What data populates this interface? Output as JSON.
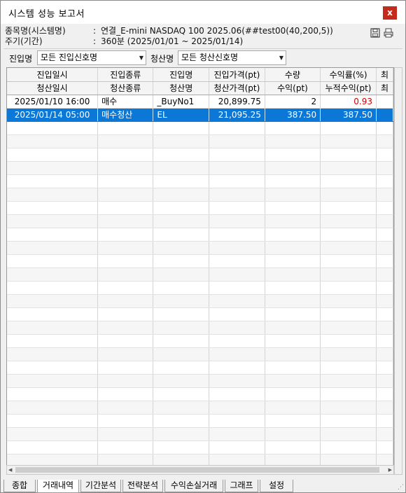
{
  "window": {
    "title": "시스템 성능 보고서",
    "close_label": "x"
  },
  "info": {
    "symbol_label": "종목명(시스템명)",
    "symbol_value": "연결_E-mini NASDAQ 100 2025.06(##test00(40,200,5))",
    "period_label": "주기(기간)",
    "period_value": "360분 (2025/01/01 ~ 2025/01/14)"
  },
  "filters": {
    "entry_label": "진입명",
    "entry_value": "모든 진입신호명",
    "exit_label": "청산명",
    "exit_value": "모든 청산신호명"
  },
  "table": {
    "header_top": [
      "진입일시",
      "진입종류",
      "진입명",
      "진입가격(pt)",
      "수량",
      "수익률(%)",
      "최"
    ],
    "header_bottom": [
      "청산일시",
      "청산종류",
      "청산명",
      "청산가격(pt)",
      "수익(pt)",
      "누적수익(pt)",
      "최"
    ],
    "rows": [
      {
        "entry": [
          "2025/01/10 16:00",
          "매수",
          "_BuyNo1",
          "20,899.75",
          "2",
          "0.93",
          ""
        ],
        "exit": [
          "2025/01/14 05:00",
          "매수청산",
          "EL",
          "21,095.25",
          "387.50",
          "387.50",
          ""
        ]
      }
    ]
  },
  "tabs": [
    "종합",
    "거래내역",
    "기간분석",
    "전략분석",
    "수익손실거래",
    "그래프",
    "설정"
  ],
  "active_tab": "거래내역",
  "colors": {
    "selection": "#0b78d7",
    "negative_return": "#d00000",
    "close_button": "#c42b1c"
  }
}
